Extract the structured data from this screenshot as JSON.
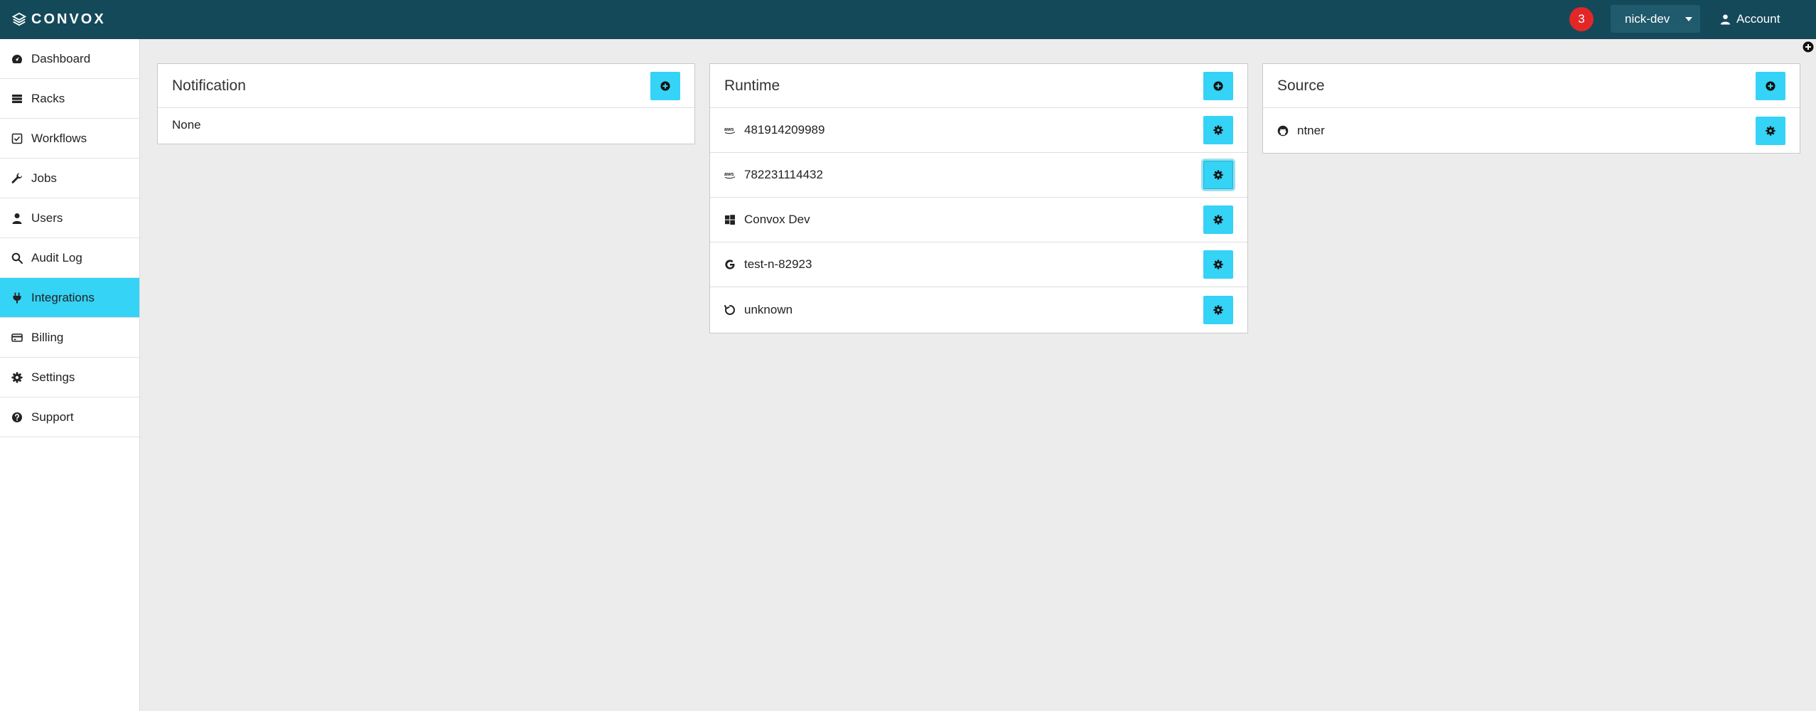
{
  "header": {
    "brand": "CONVOX",
    "notification_count": "3",
    "rack": "nick-dev",
    "account_label": "Account"
  },
  "sidebar": {
    "items": [
      {
        "label": "Dashboard",
        "icon": "dashboard-icon"
      },
      {
        "label": "Racks",
        "icon": "server-icon"
      },
      {
        "label": "Workflows",
        "icon": "check-square-icon"
      },
      {
        "label": "Jobs",
        "icon": "wrench-icon"
      },
      {
        "label": "Users",
        "icon": "user-icon"
      },
      {
        "label": "Audit Log",
        "icon": "search-icon"
      },
      {
        "label": "Integrations",
        "icon": "plug-icon",
        "active": true
      },
      {
        "label": "Billing",
        "icon": "credit-card-icon"
      },
      {
        "label": "Settings",
        "icon": "gear-icon"
      },
      {
        "label": "Support",
        "icon": "question-circle-icon"
      }
    ]
  },
  "notification": {
    "title": "Notification",
    "empty_text": "None"
  },
  "runtime": {
    "title": "Runtime",
    "items": [
      {
        "label": "481914209989",
        "icon": "aws-icon"
      },
      {
        "label": "782231114432",
        "icon": "aws-icon"
      },
      {
        "label": "Convox Dev",
        "icon": "windows-icon"
      },
      {
        "label": "test-n-82923",
        "icon": "google-icon"
      },
      {
        "label": "unknown",
        "icon": "spinner-icon"
      }
    ]
  },
  "source": {
    "title": "Source",
    "items": [
      {
        "label": "ntner",
        "icon": "github-icon"
      }
    ]
  },
  "colors": {
    "topbar": "#14495a",
    "accent": "#35d3f5",
    "badge": "#e32727",
    "background": "#ececec"
  }
}
